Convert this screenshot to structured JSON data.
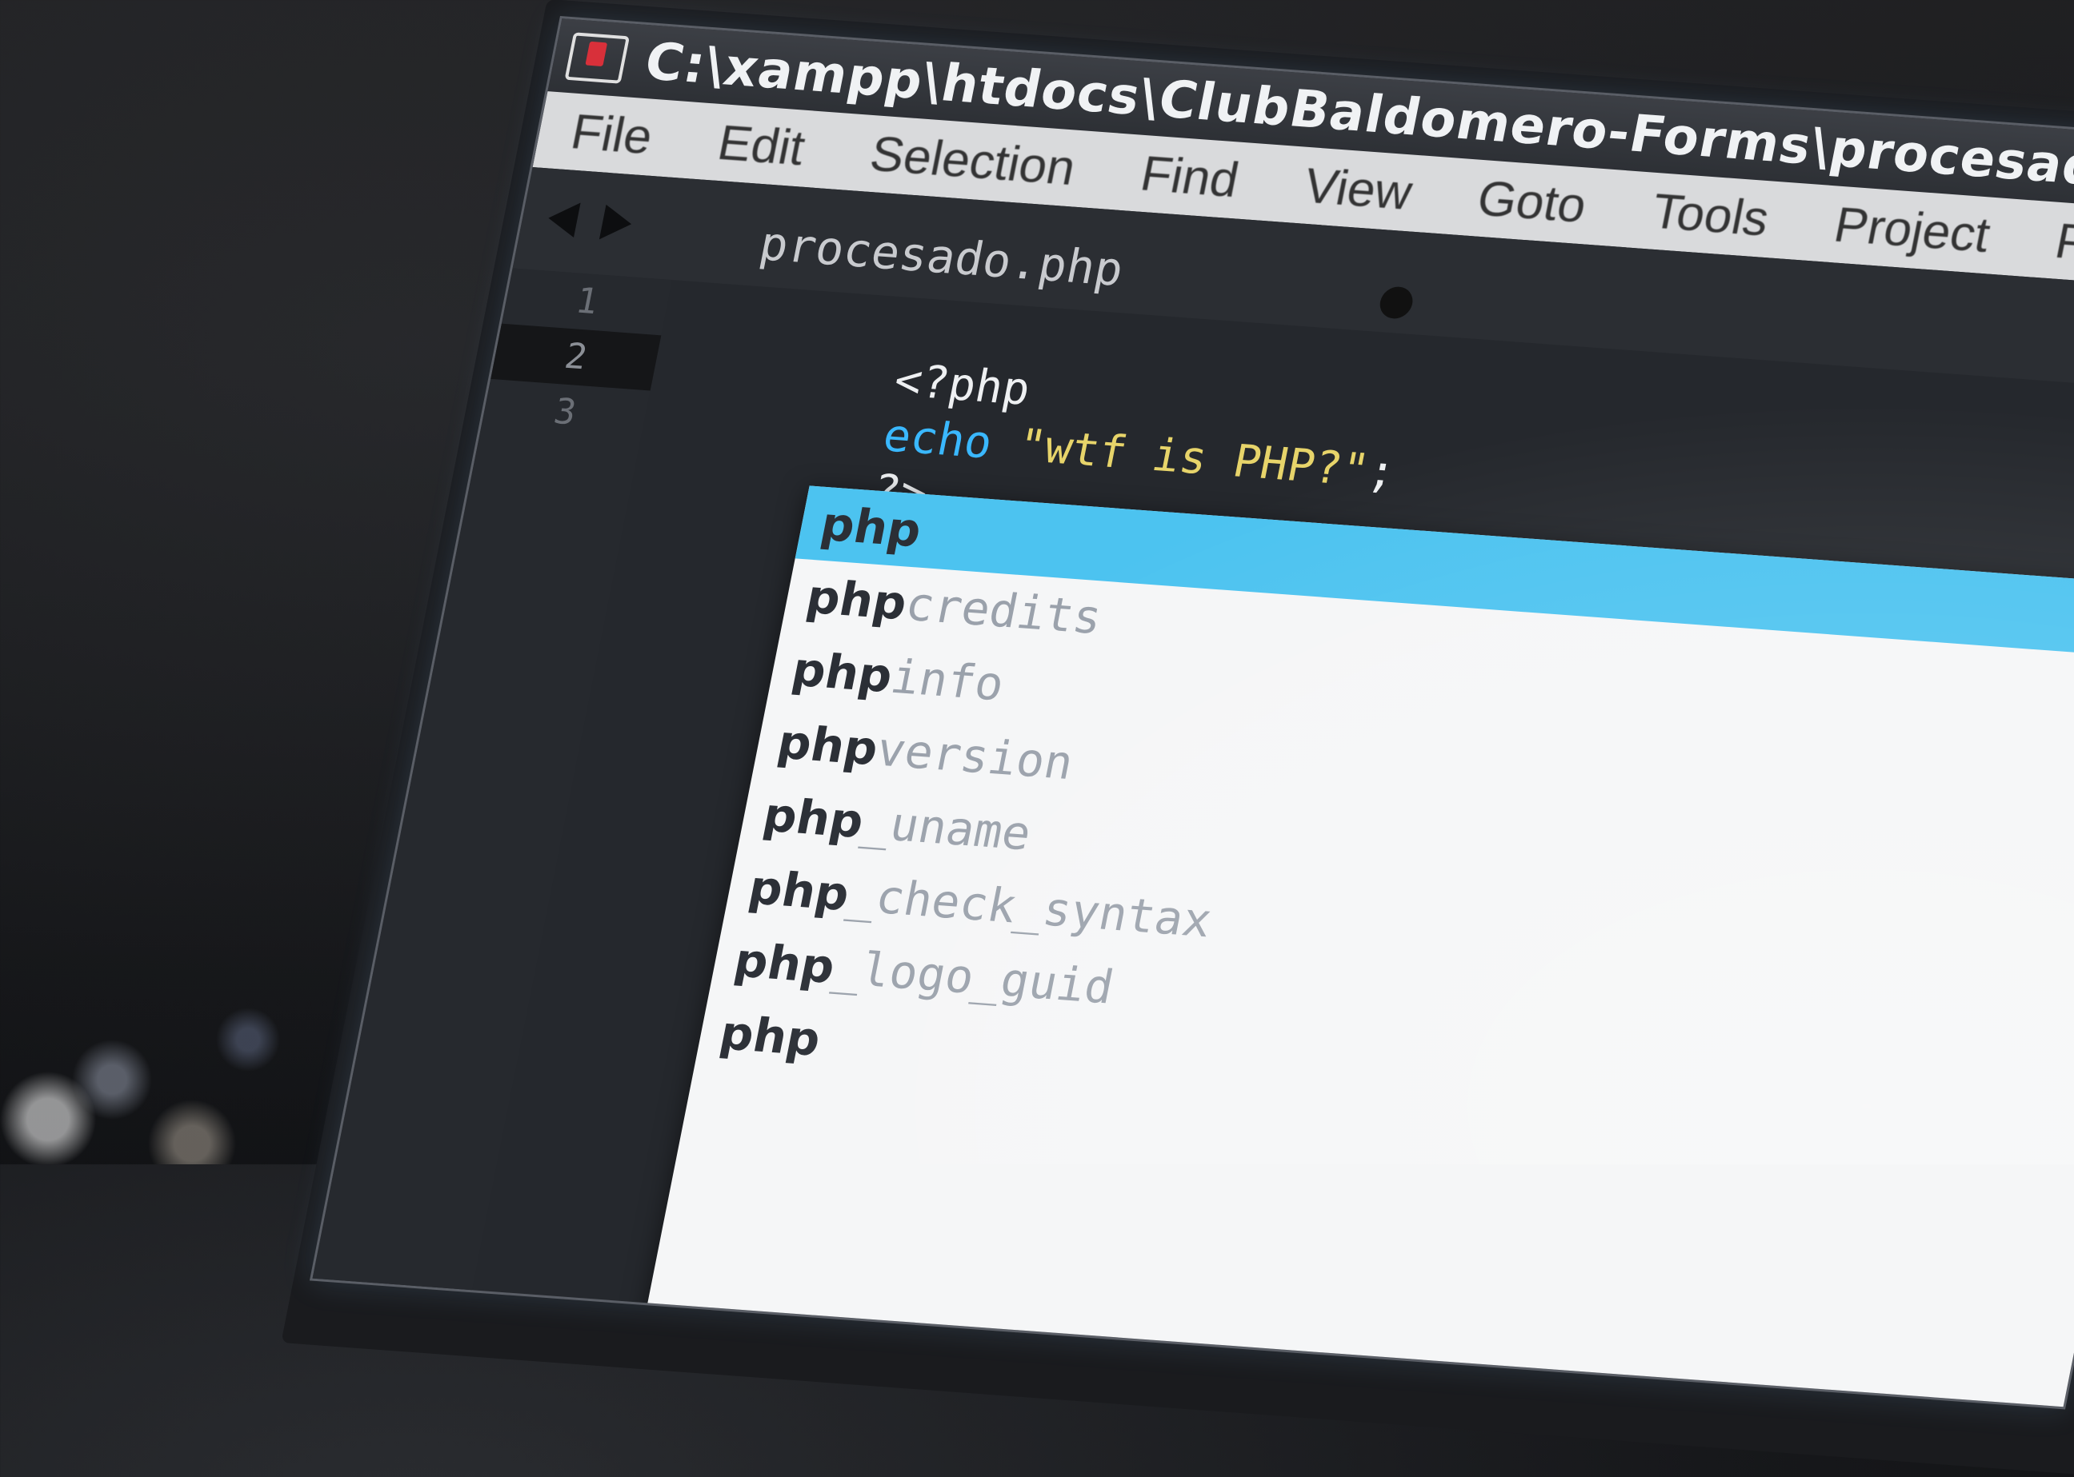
{
  "window": {
    "title": "C:\\xampp\\htdocs\\ClubBaldomero-Forms\\procesad"
  },
  "menu": {
    "items": [
      "File",
      "Edit",
      "Selection",
      "Find",
      "View",
      "Goto",
      "Tools",
      "Project",
      "P"
    ]
  },
  "tab": {
    "label": "procesado.php"
  },
  "gutter": {
    "lines": [
      "1",
      "2",
      "3"
    ]
  },
  "code": {
    "line1": "<?php",
    "line2_kw": "echo",
    "line2_str": "\"wtf is PHP?\"",
    "line2_end": ";",
    "line3": "?>"
  },
  "autocomplete": {
    "items": [
      {
        "match": "php",
        "rest": ""
      },
      {
        "match": "php",
        "rest": "credits"
      },
      {
        "match": "php",
        "rest": "info"
      },
      {
        "match": "php",
        "rest": "version"
      },
      {
        "match": "php",
        "rest": "_uname"
      },
      {
        "match": "php",
        "rest": "_check_syntax"
      },
      {
        "match": "php",
        "rest": "_logo_guid"
      },
      {
        "match": "php",
        "rest": ""
      }
    ]
  },
  "colors": {
    "selection": "#4cc3f0",
    "keyword": "#3ab8ff",
    "string": "#e7d46a"
  }
}
